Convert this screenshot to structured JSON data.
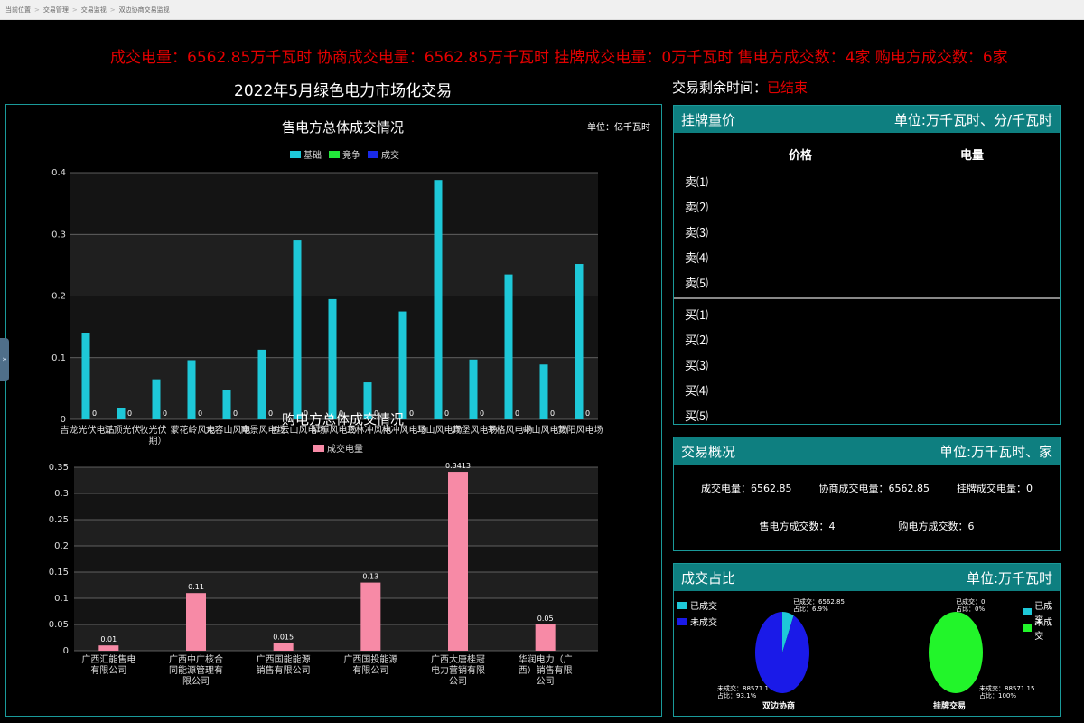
{
  "breadcrumb": [
    "当前位置",
    "交易管理",
    "交易监视",
    "双边协商交易监视"
  ],
  "summary": "成交电量：6562.85万千瓦时  协商成交电量：6562.85万千瓦时  挂牌成交电量：0万千瓦时  售电方成交数：4家  购电方成交数：6家",
  "main_title": "2022年5月绿色电力市场化交易",
  "remain": {
    "label": "交易剩余时间：",
    "value": "已结束"
  },
  "side_toggle": "»",
  "chart1": {
    "title": "售电方总体成交情况",
    "unit": "单位：亿千瓦时"
  },
  "chart2": {
    "title": "购电方总体成交情况"
  },
  "chart_data": [
    {
      "type": "bar",
      "title": "售电方总体成交情况",
      "unit": "单位：亿千瓦时",
      "ylim": [
        0,
        0.4
      ],
      "yticks": [
        0,
        0.1,
        0.2,
        0.3,
        0.4
      ],
      "grid": true,
      "legend_placement": "top-center",
      "categories": [
        "吉龙光伏电站",
        "江顶光伏",
        "牧光伏（二期）",
        "蒙花岭风电场",
        "大容山风电场",
        "南景风电场",
        "金云山风电场",
        "犁樟风电场",
        "三林冲风电场",
        "林冲风电场",
        "马山风电场",
        "宾堡风电场",
        "平格风电场",
        "中山风电场",
        "贺阳风电场"
      ],
      "category_labels": [
        "吉龙光伏电站",
        "江顶光伏",
        "牧光伏（",
        "蒙花岭风电",
        "大容山风电",
        "南景风电场",
        "金云山风电场",
        "犁樟风电场",
        "三林冲风电",
        "林冲风电场",
        "马山风电场",
        "宾堡风电场",
        "平格风电场",
        "中山风电场",
        "贺阳风电场"
      ],
      "series": [
        {
          "name": "基础",
          "color": "#1ec8d8",
          "values": [
            0.14,
            0.018,
            0.065,
            0.096,
            0.048,
            0.113,
            0.29,
            0.195,
            0.06,
            0.175,
            0.388,
            0.097,
            0.235,
            0.089,
            0.252
          ]
        },
        {
          "name": "竞争",
          "color": "#22e83a",
          "values": [
            0,
            0,
            0,
            0,
            0,
            0,
            0,
            0,
            0,
            0,
            0,
            0,
            0,
            0,
            0
          ]
        },
        {
          "name": "成交",
          "color": "#1a2ae8",
          "values": [
            0,
            0,
            0,
            0,
            0,
            0,
            0,
            0,
            0,
            0,
            0,
            0,
            0,
            0,
            0
          ]
        }
      ],
      "extra_axis_text": "期）",
      "value_label_text": "0"
    },
    {
      "type": "bar",
      "title": "购电方总体成交情况",
      "ylim": [
        0,
        0.35
      ],
      "yticks": [
        0,
        0.05,
        0.1,
        0.15,
        0.2,
        0.25,
        0.3,
        0.35
      ],
      "grid": true,
      "legend_placement": "top-center",
      "categories": [
        "广西汇能售电有限公司",
        "广西中广核合同能源管理有限公司",
        "广西国能能源销售有限公司",
        "广西国投能源有限公司",
        "广西大唐桂冠电力营销有限公司",
        "华润电力（广西）销售有限公司"
      ],
      "category_lines": [
        [
          "广西汇能售电",
          "有限公司"
        ],
        [
          "广西中广核合",
          "同能源管理有",
          "限公司"
        ],
        [
          "广西国能能源",
          "销售有限公司"
        ],
        [
          "广西国投能源",
          "有限公司"
        ],
        [
          "广西大唐桂冠",
          "电力营销有限",
          "公司"
        ],
        [
          "华润电力（广",
          "西）销售有限",
          "公司"
        ]
      ],
      "series": [
        {
          "name": "成交电量",
          "color": "#f78aa6",
          "values": [
            0.01,
            0.11,
            0.015,
            0.13,
            0.3413,
            0.05
          ]
        }
      ],
      "data_labels": [
        "0.01",
        "0.11",
        "0.015",
        "0.13",
        "0.3413",
        "0.05"
      ]
    },
    {
      "type": "pie",
      "title": "双边协商",
      "slices": [
        {
          "name": "已成交",
          "value": 6562.85,
          "share": "6.9%",
          "color": "#1ec8d8"
        },
        {
          "name": "未成交",
          "value": 88571.15,
          "share": "93.1%",
          "color": "#1a1ae8"
        }
      ]
    },
    {
      "type": "pie",
      "title": "挂牌交易",
      "slices": [
        {
          "name": "已成交",
          "value": 0,
          "share": "0%",
          "color": "#1ec8d8"
        },
        {
          "name": "未成交",
          "value": 88571.15,
          "share": "100%",
          "color": "#22f52a"
        }
      ]
    }
  ],
  "orderbook": {
    "title": "挂牌量价",
    "unit": "单位:万千瓦时、分/千瓦时",
    "col_price": "价格",
    "col_qty": "电量",
    "sell": [
      "卖⑴",
      "卖⑵",
      "卖⑶",
      "卖⑷",
      "卖⑸"
    ],
    "buy": [
      "买⑴",
      "买⑵",
      "买⑶",
      "买⑷",
      "买⑸"
    ]
  },
  "overview": {
    "title": "交易概况",
    "unit": "单位:万千瓦时、家",
    "total": "成交电量：6562.85",
    "negotiated": "协商成交电量：6562.85",
    "listed": "挂牌成交电量：0",
    "sellers": "售电方成交数：4",
    "buyers": "购电方成交数：6"
  },
  "ratio": {
    "title": "成交占比",
    "unit": "单位:万千瓦时",
    "leg_done": "已成交",
    "leg_undone": "未成交",
    "pie1": {
      "done_line1": "已成交：6562.85",
      "done_line2": "占比：6.9%",
      "undone_line1": "未成交：88571.15",
      "undone_line2": "占比：93.1%",
      "name": "双边协商"
    },
    "pie2": {
      "done_line1": "已成交：0",
      "done_line2": "占比：0%",
      "undone_line1": "未成交：88571.15",
      "undone_line2": "占比：100%",
      "name": "挂牌交易"
    }
  }
}
